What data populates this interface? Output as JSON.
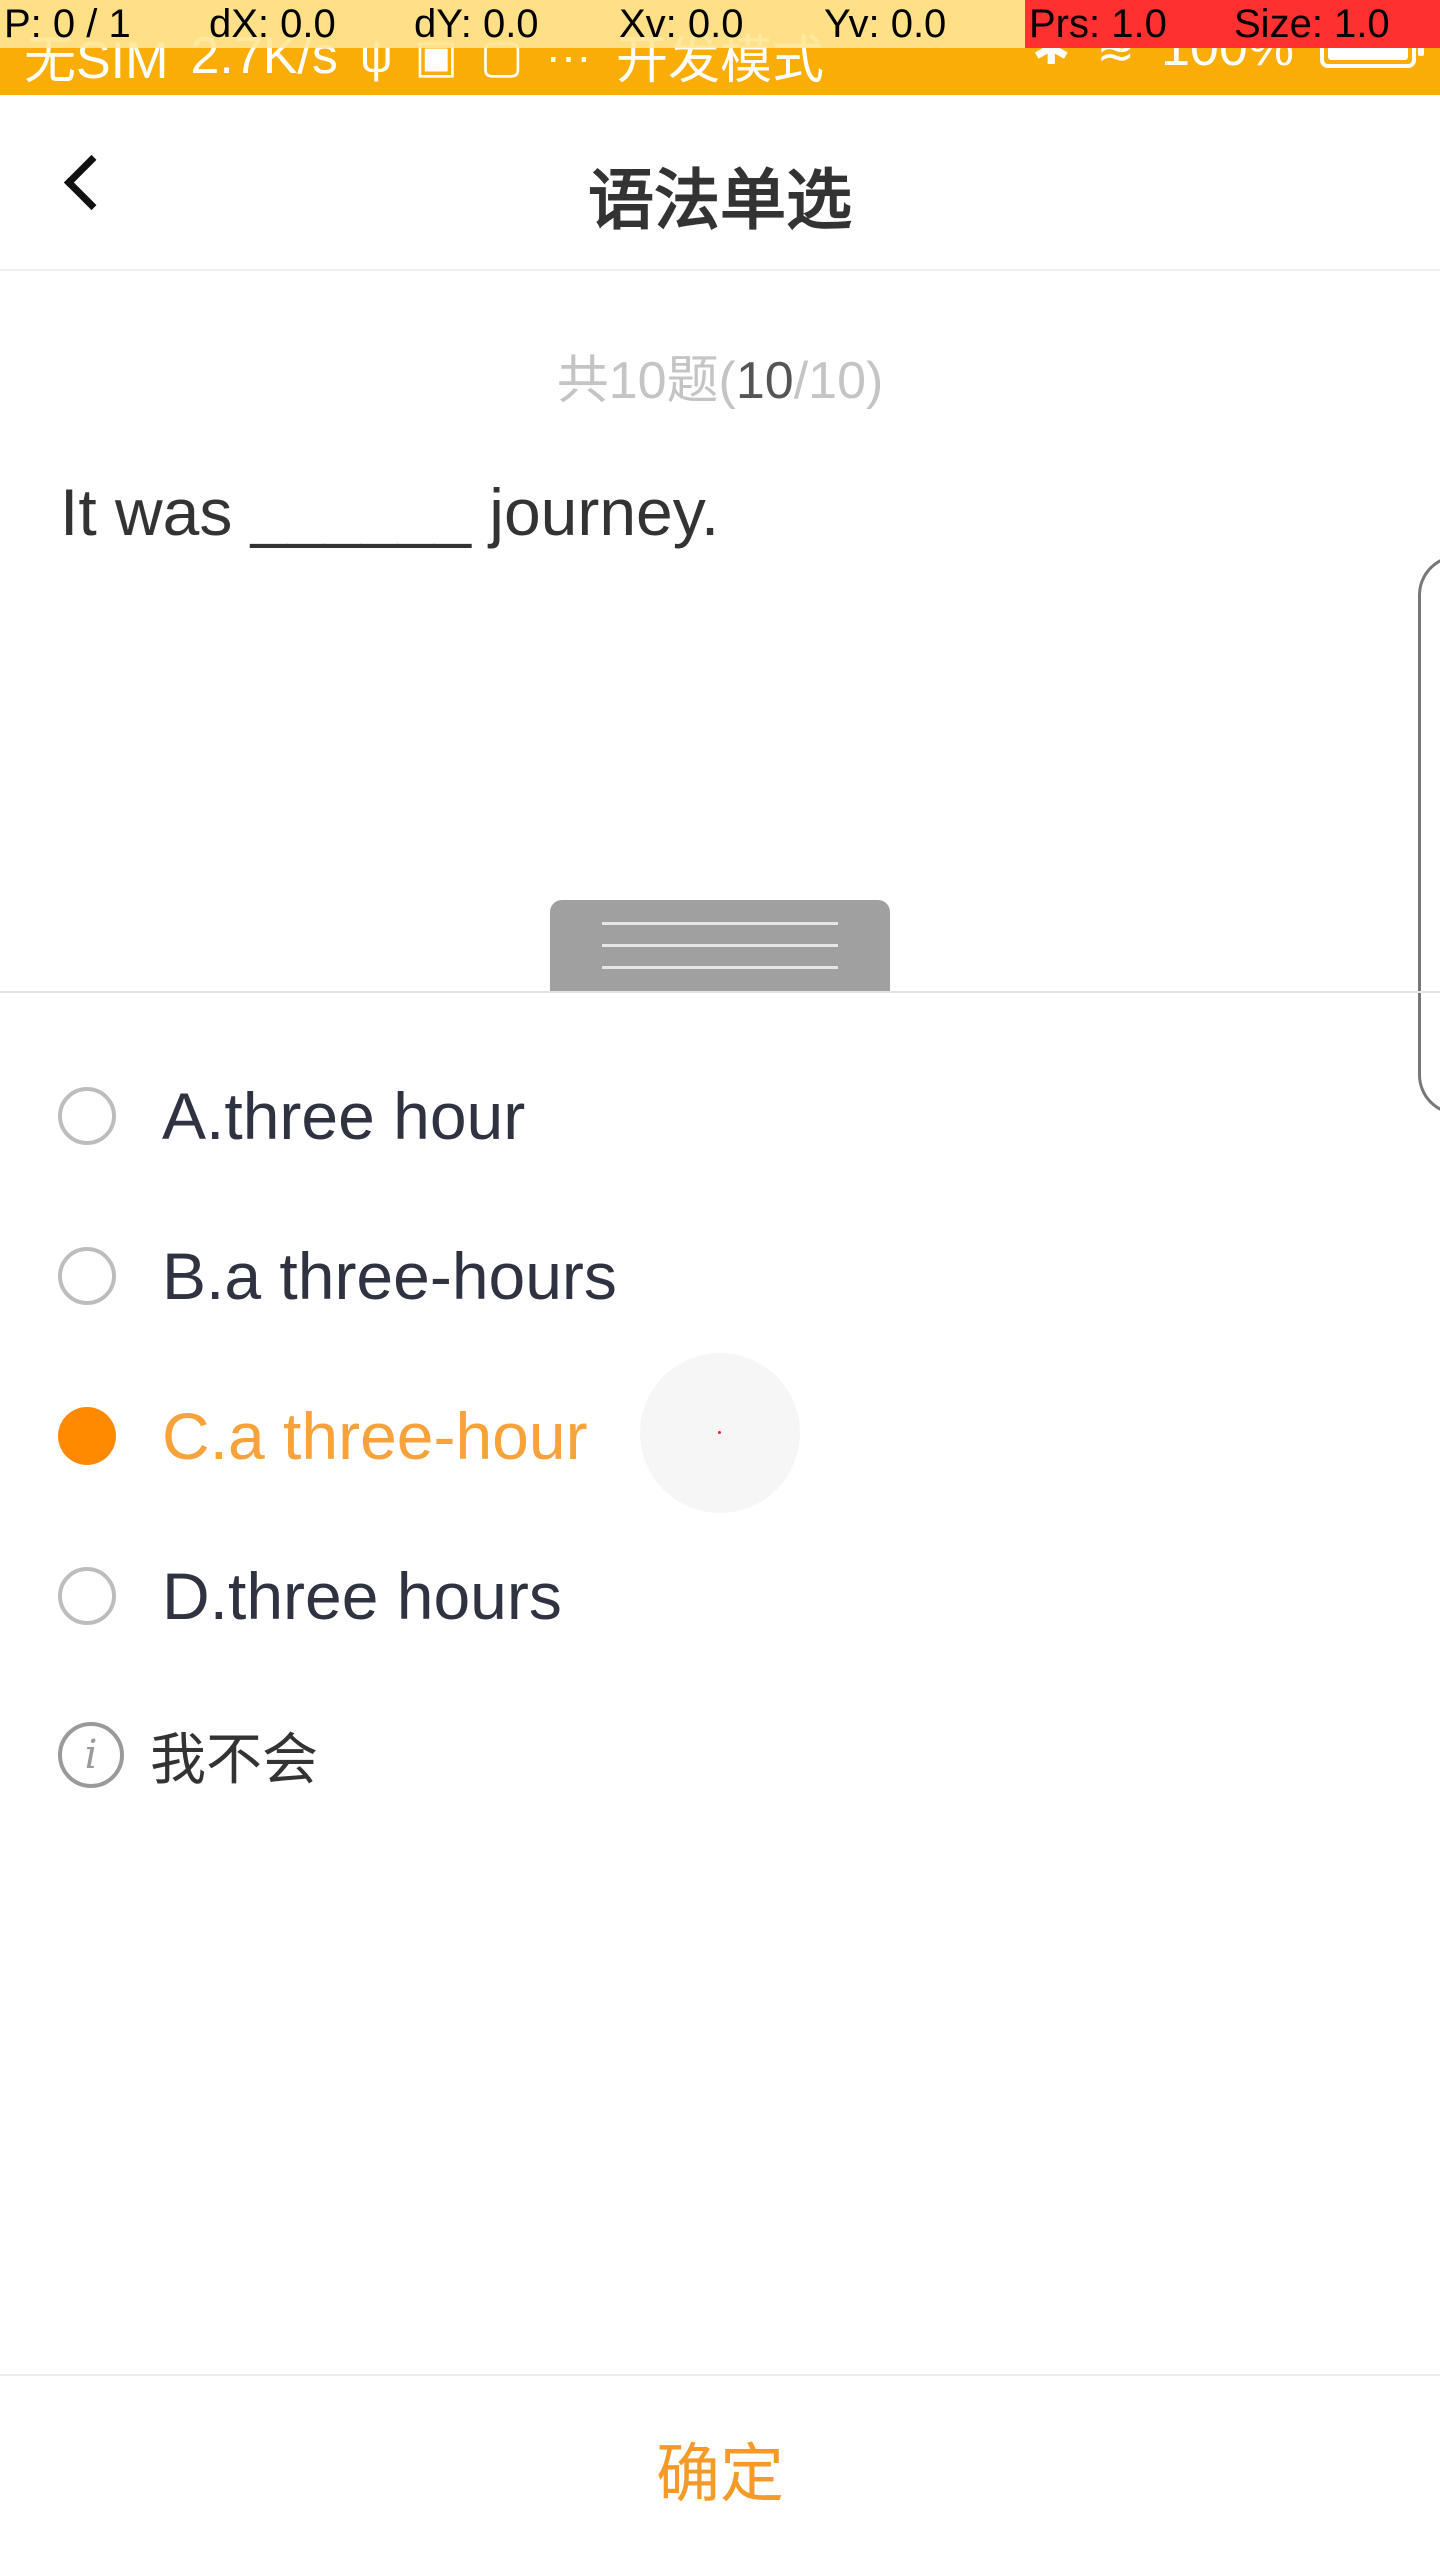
{
  "status_bar": {
    "carrier": "无SIM",
    "speed": "2.7K/s",
    "mode": "开发模式",
    "battery": "100%",
    "background_color": "#f9ad06"
  },
  "debug_overlay": {
    "pointer": "P: 0 / 1",
    "dx": "dX: 0.0",
    "dy": "dY: 0.0",
    "xv": "Xv: 0.0",
    "yv": "Yv: 0.0",
    "prs": "Prs: 1.0",
    "size": "Size: 1.0"
  },
  "header": {
    "title": "语法单选",
    "back_icon": "chevron-left-icon"
  },
  "question": {
    "counter_prefix": "共10题(",
    "counter_current": "10",
    "counter_suffix": "/10)",
    "text": "It was ______ journey."
  },
  "options": [
    {
      "label": "A.three hour",
      "selected": false
    },
    {
      "label": "B.a three-hours",
      "selected": false
    },
    {
      "label": "C.a three-hour",
      "selected": true
    },
    {
      "label": "D.three hours",
      "selected": false
    }
  ],
  "dont_know": {
    "label": "我不会",
    "icon": "info-icon"
  },
  "confirm": {
    "label": "确定"
  },
  "colors": {
    "accent": "#ff8a00",
    "selected_text": "#f7a23a",
    "confirm_text": "#f59a27"
  }
}
